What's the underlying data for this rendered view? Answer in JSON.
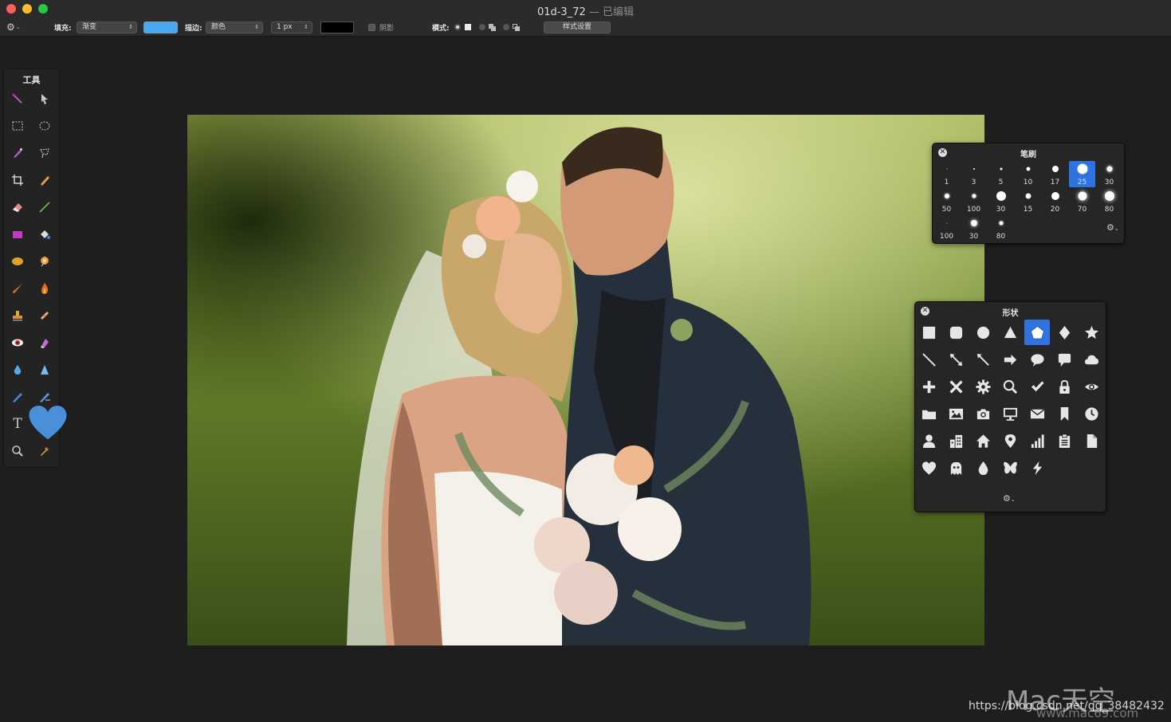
{
  "window": {
    "title": "01d-3_72",
    "separator": "—",
    "edited": "已编辑"
  },
  "toolbar": {
    "fill_label": "填充:",
    "fill_value": "渐变",
    "fill_color": "#4aa6ef",
    "stroke_label": "描边:",
    "stroke_value": "颜色",
    "stroke_width": "1 px",
    "stroke_color": "#000000",
    "shadow_label": "阴影",
    "mode_label": "模式:",
    "style_button": "样式设置"
  },
  "tools": {
    "title": "工具",
    "current_color": "#4a90d9"
  },
  "brush_panel": {
    "title": "笔刷",
    "selected": 5,
    "items": [
      {
        "label": "1"
      },
      {
        "label": "3"
      },
      {
        "label": "5"
      },
      {
        "label": "10"
      },
      {
        "label": "17"
      },
      {
        "label": "25"
      },
      {
        "label": "30"
      },
      {
        "label": "50"
      },
      {
        "label": "100"
      },
      {
        "label": "30"
      },
      {
        "label": "15"
      },
      {
        "label": "20"
      },
      {
        "label": "70"
      },
      {
        "label": "80"
      },
      {
        "label": "100"
      },
      {
        "label": "30"
      },
      {
        "label": "80"
      }
    ]
  },
  "shape_panel": {
    "title": "形状",
    "selected": "pentagon",
    "shapes": [
      "square",
      "rounded-square",
      "circle",
      "triangle",
      "pentagon",
      "diamond",
      "star",
      "line",
      "double-arrow",
      "arrow-line",
      "arrow-right",
      "speech-bubble",
      "chat-bubble",
      "cloud",
      "plus",
      "cross",
      "gear",
      "magnifier",
      "check",
      "lock",
      "eye",
      "folder",
      "picture",
      "camera",
      "monitor",
      "mail",
      "bookmark",
      "clock",
      "person",
      "building",
      "house",
      "pin",
      "bars",
      "clipboard",
      "document",
      "heart",
      "ghost",
      "drop",
      "butterfly",
      "bolt"
    ]
  },
  "watermark": {
    "logo": "Mac天空",
    "url": "https://blog.csdn.net/qq_38482432",
    "domain": "www.mac69.com"
  }
}
